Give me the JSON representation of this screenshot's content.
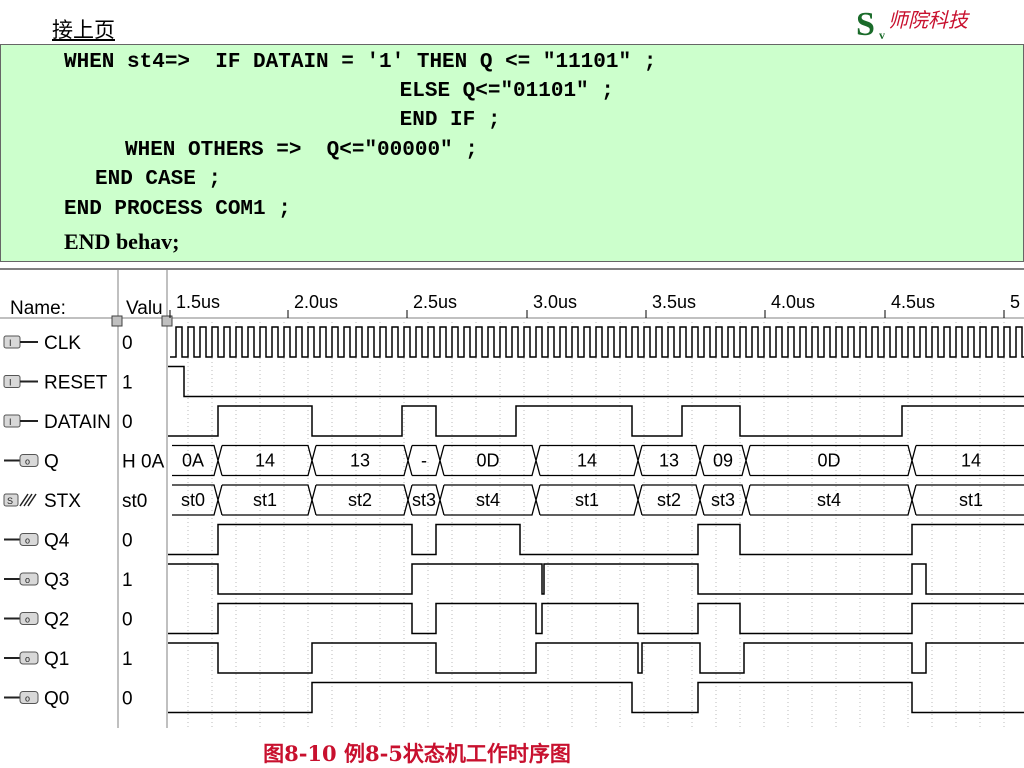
{
  "header": {
    "continue_label": "接上页"
  },
  "logo": {
    "letter": "S",
    "sub": "v",
    "text": "师院科技"
  },
  "code": {
    "lines": [
      "WHEN st4=>  IF DATAIN = '1' THEN Q <= \"11101\" ;",
      "                ELSE Q<=\"01101\" ;",
      "                END IF ;",
      "WHEN OTHERS =>  Q<=\"00000\" ;",
      "END CASE ;",
      "END PROCESS COM1 ;",
      "END behav;"
    ]
  },
  "waveform": {
    "name_header": "Name:",
    "value_header": "Valu",
    "time_ticks": [
      "1.5us",
      "2.0us",
      "2.5us",
      "3.0us",
      "3.5us",
      "4.0us",
      "4.5us",
      "5"
    ],
    "signals": [
      {
        "name": "CLK",
        "value": "0",
        "kind": "input"
      },
      {
        "name": "RESET",
        "value": "1",
        "kind": "input"
      },
      {
        "name": "DATAIN",
        "value": "0",
        "kind": "input"
      },
      {
        "name": "Q",
        "value": "H 0A",
        "kind": "bus-output"
      },
      {
        "name": "STX",
        "value": "st0",
        "kind": "state"
      },
      {
        "name": "Q4",
        "value": "0",
        "kind": "output"
      },
      {
        "name": "Q3",
        "value": "1",
        "kind": "output"
      },
      {
        "name": "Q2",
        "value": "0",
        "kind": "output"
      },
      {
        "name": "Q1",
        "value": "1",
        "kind": "output"
      },
      {
        "name": "Q0",
        "value": "0",
        "kind": "output"
      }
    ],
    "q_bus_labels": [
      "0A",
      "14",
      "13",
      "-",
      "0D",
      "14",
      "13",
      "09",
      "0D",
      "14"
    ],
    "stx_bus_labels": [
      "st0",
      "st1",
      "st2",
      "st3",
      "st4",
      "st1",
      "st2",
      "st3",
      "st4",
      "st1"
    ]
  },
  "caption": "图8-10  例8-5状态机工作时序图"
}
